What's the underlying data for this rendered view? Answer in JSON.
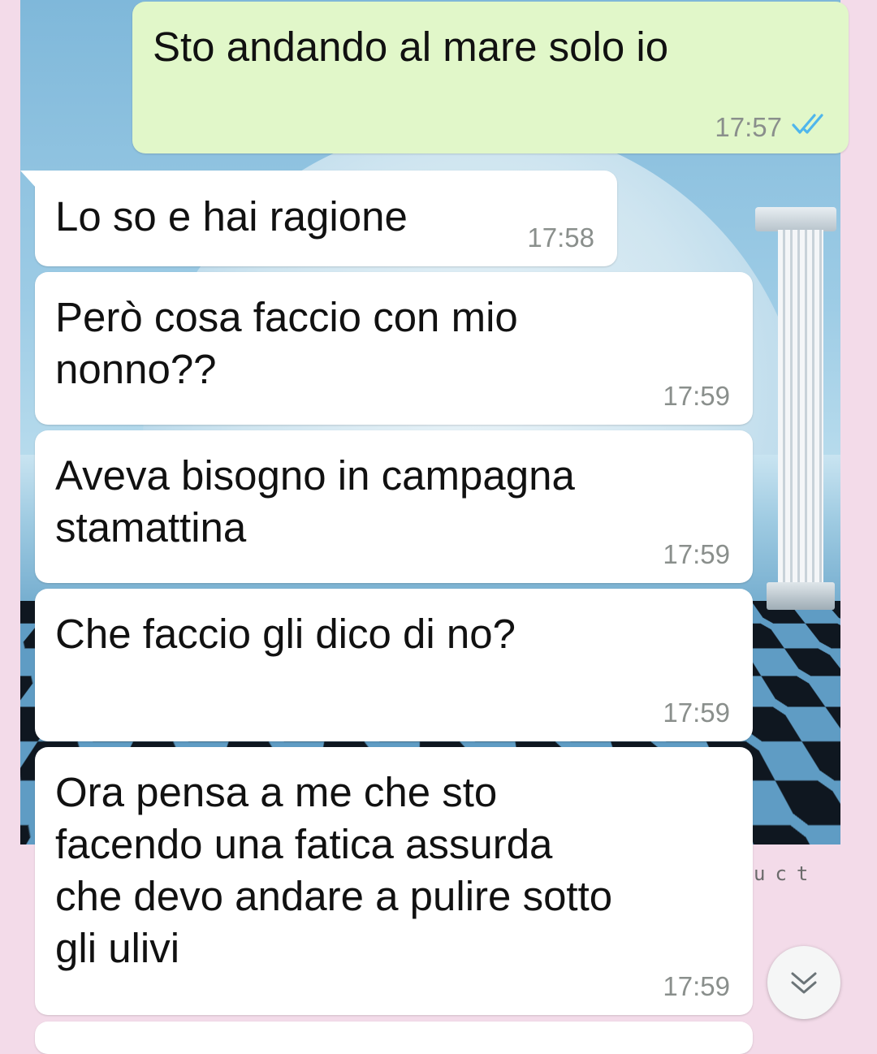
{
  "chat": {
    "messages": [
      {
        "direction": "out",
        "text": "Sto andando al mare solo io",
        "time": "17:57",
        "status": "read"
      },
      {
        "direction": "in",
        "text": "Lo so e hai ragione",
        "time": "17:58"
      },
      {
        "direction": "in",
        "text": "Però cosa faccio con mio\nnonno??",
        "time": "17:59"
      },
      {
        "direction": "in",
        "text": "Aveva bisogno in campagna\nstamattina",
        "time": "17:59"
      },
      {
        "direction": "in",
        "text": "Che faccio gli dico di no?",
        "time": "17:59"
      },
      {
        "direction": "in",
        "text": "Ora pensa a me che sto\nfacendo una fatica assurda\nche devo andare a pulire sotto\ngli ulivi",
        "time": "17:59"
      }
    ]
  },
  "wallpaper": {
    "caption": "uct"
  },
  "colors": {
    "outgoing_bubble": "#e1f7c9",
    "incoming_bubble": "#ffffff",
    "read_ticks": "#4fb6ec",
    "timestamp": "#8a8f8c"
  },
  "icons": {
    "read_receipt": "double-check-icon",
    "scroll_down": "double-chevron-down-icon"
  }
}
